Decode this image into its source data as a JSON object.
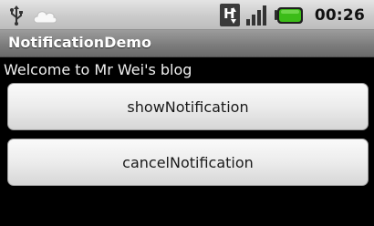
{
  "status_bar": {
    "icons": [
      "usb-icon",
      "cloud-icon",
      "hsdpa-icon",
      "signal-icon",
      "battery-icon"
    ],
    "network_label": "H",
    "time": "00:26",
    "battery_color": "#3cbc18"
  },
  "app": {
    "title": "NotificationDemo",
    "welcome_text": "Welcome to Mr Wei's blog"
  },
  "buttons": {
    "show_label": "showNotification",
    "cancel_label": "cancelNotification"
  }
}
